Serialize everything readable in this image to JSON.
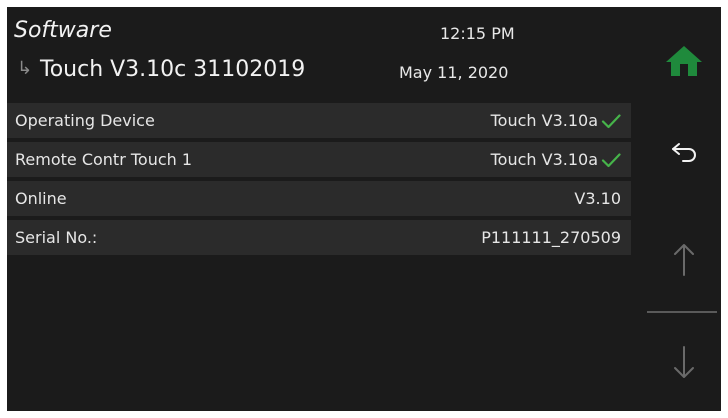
{
  "header": {
    "title": "Software",
    "subtitle_arrow": "↳",
    "subtitle": "Touch V3.10c 31102019",
    "time": "12:15 PM",
    "date": "May 11, 2020"
  },
  "rows": [
    {
      "label": "Operating Device",
      "value": "Touch V3.10a",
      "check": true
    },
    {
      "label": "Remote Contr Touch 1",
      "value": "Touch V3.10a",
      "check": true
    },
    {
      "label": "Online",
      "value": "V3.10",
      "check": false
    },
    {
      "label": "Serial No.:",
      "value": "P111111_270509",
      "check": false
    }
  ],
  "sidebar": {
    "home_icon": "home-icon",
    "back_icon": "back-arrow-icon",
    "up_icon": "up-arrow-icon",
    "down_icon": "down-arrow-icon"
  },
  "colors": {
    "background": "#1b1b1b",
    "row_background": "#2b2b2b",
    "home_green": "#1f8a3c",
    "check_green": "#46b44a",
    "text": "#ececec",
    "disabled_arrow": "#6a6a6a"
  }
}
